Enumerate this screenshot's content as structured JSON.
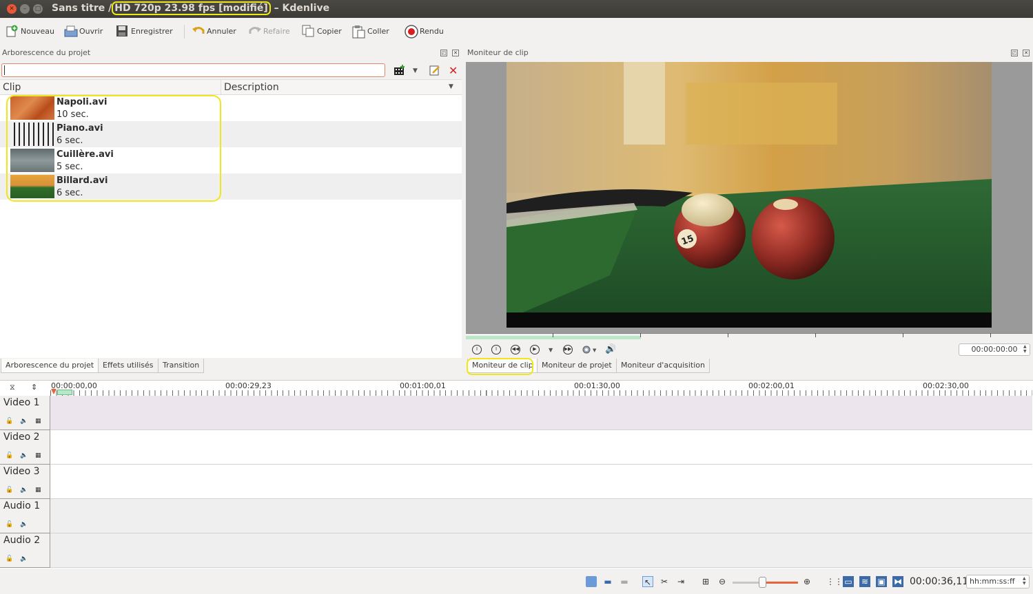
{
  "window": {
    "title_prefix": "Sans titre /",
    "title_profile": "HD 720p 23.98 fps [modifié]",
    "title_suffix": "– Kdenlive"
  },
  "toolbar": {
    "nouveau": "Nouveau",
    "ouvrir": "Ouvrir",
    "enregistrer": "Enregistrer",
    "annuler": "Annuler",
    "refaire": "Refaire",
    "copier": "Copier",
    "coller": "Coller",
    "rendu": "Rendu"
  },
  "project_tree": {
    "title": "Arborescence du projet",
    "search_value": "",
    "columns": [
      "Clip",
      "Description"
    ],
    "clips": [
      {
        "name": "Napoli.avi",
        "duration": "10 sec."
      },
      {
        "name": "Piano.avi",
        "duration": "6 sec."
      },
      {
        "name": "Cuillère.avi",
        "duration": "5 sec."
      },
      {
        "name": "Billard.avi",
        "duration": "6 sec."
      }
    ],
    "tabs": [
      "Arborescence du projet",
      "Effets utilisés",
      "Transition"
    ]
  },
  "monitor": {
    "title": "Moniteur de clip",
    "timecode": "00:00:00:00",
    "tabs": [
      "Moniteur de clip",
      "Moniteur de projet",
      "Moniteur d'acquisition"
    ]
  },
  "timeline": {
    "ruler_labels": [
      "00:00:00,00",
      "00:00:29,23",
      "00:01:00,01",
      "00:01:30,00",
      "00:02:00,01",
      "00:02:30,00"
    ],
    "tracks": [
      {
        "name": "Video 1",
        "kind": "video"
      },
      {
        "name": "Video 2",
        "kind": "video"
      },
      {
        "name": "Video 3",
        "kind": "video"
      },
      {
        "name": "Audio 1",
        "kind": "audio"
      },
      {
        "name": "Audio 2",
        "kind": "audio"
      }
    ]
  },
  "statusbar": {
    "timecode": "00:00:36,11",
    "format": "hh:mm:ss:ff",
    "zoom_level_fraction": 0.47
  },
  "colors": {
    "highlight": "#f1e61a",
    "accent": "#e8633a"
  }
}
